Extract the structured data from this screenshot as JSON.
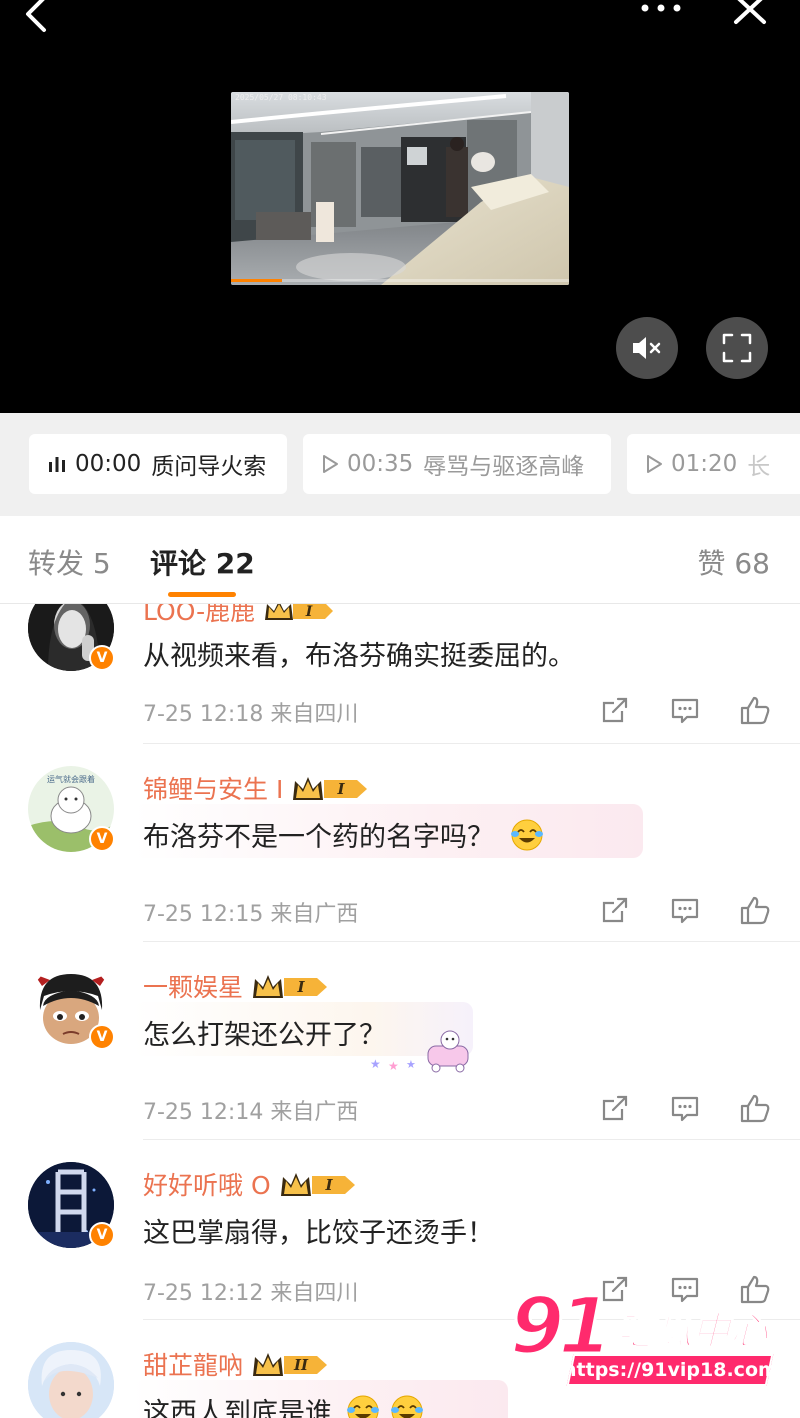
{
  "video": {
    "timestamp": "2025/05/27 08:10:43",
    "progress": 0.15
  },
  "chapters": [
    {
      "time": "00:00",
      "title": "质问导火索",
      "state": "active"
    },
    {
      "time": "00:35",
      "title": "辱骂与驱逐高峰",
      "state": "inactive"
    },
    {
      "time": "01:20",
      "title": "长",
      "state": "inactive"
    }
  ],
  "tabs": {
    "repost_label": "转发 5",
    "comment_label": "评论 22",
    "like_label": "赞 68"
  },
  "comments": [
    {
      "username": "LOO-鹿鹿",
      "level": "I",
      "text": "从视频来看，布洛芬确实挺委屈的。",
      "date": "7-25 12:18",
      "location": "来自四川"
    },
    {
      "username": "锦鲤与安生 I",
      "level": "I",
      "text": "布洛芬不是一个药的名字吗？",
      "emoji": "laugh-cry-emoji",
      "date": "7-25 12:15",
      "location": "来自广西",
      "avatar_caption": "运气就会跟着"
    },
    {
      "username": "一颗娱星",
      "level": "I",
      "text": "怎么打架还公开了？",
      "date": "7-25 12:14",
      "location": "来自广西"
    },
    {
      "username": "好好听哦 O",
      "level": "I",
      "text": "这巴掌扇得，比饺子还烫手！",
      "date": "7-25 12:12",
      "location": "来自四川"
    },
    {
      "username": "甜芷龍吶",
      "level": "II",
      "text": "这西人到底是谁",
      "emoji": "laugh-cry-emoji"
    }
  ],
  "watermark": {
    "logo_number": "91",
    "logo_text": "吃瓜中心",
    "url": "https://91vip18.com"
  },
  "colors": {
    "accent": "#ff8200",
    "username": "#eb7350",
    "watermark": "#ff2a6d"
  }
}
